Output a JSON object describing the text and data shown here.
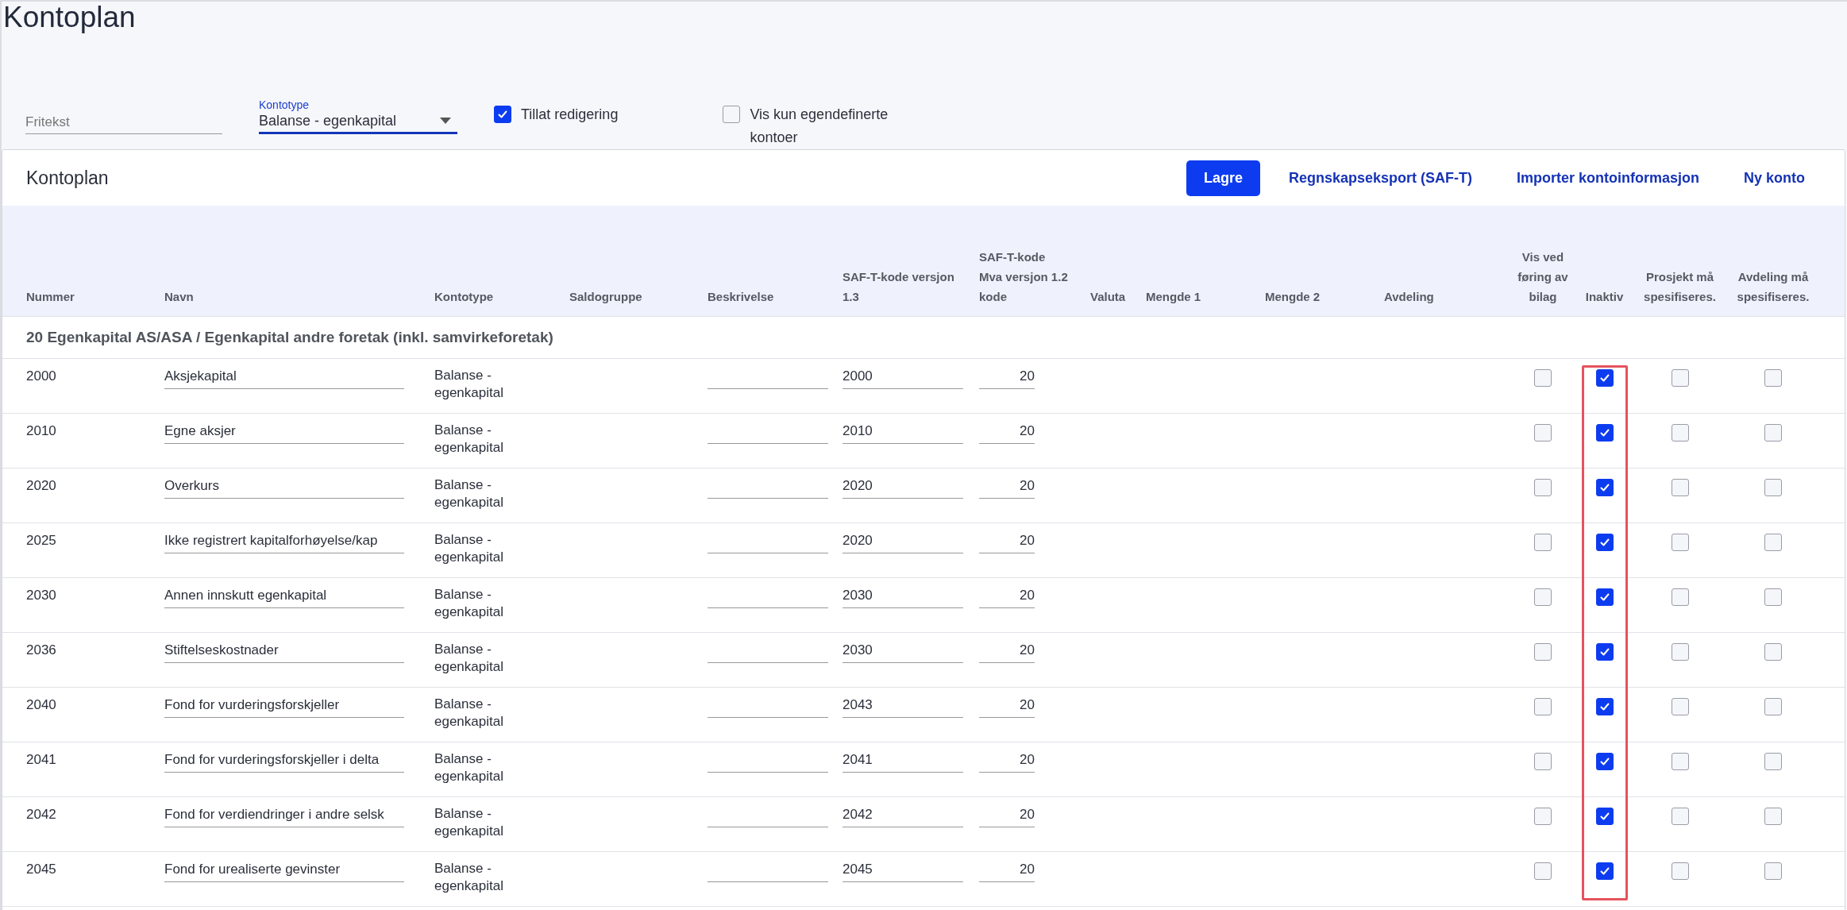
{
  "page_title": "Kontoplan",
  "filters": {
    "search": {
      "placeholder": "Fritekst"
    },
    "kontotype": {
      "label": "Kontotype",
      "value": "Balanse - egenkapital"
    },
    "checkboxes": [
      {
        "label": "Tillat redigering",
        "checked": true
      },
      {
        "label": "Vis kun egendefinerte kontoer",
        "checked": false
      }
    ]
  },
  "card_title": "Kontoplan",
  "actions": [
    {
      "label": "Lagre",
      "kind": "primary"
    },
    {
      "label": "Regnskapseksport (SAF-T)",
      "kind": "link"
    },
    {
      "label": "Importer kontoinformasjon",
      "kind": "link"
    },
    {
      "label": "Ny konto",
      "kind": "link"
    }
  ],
  "columns": [
    {
      "label": "Nummer",
      "kind": "text",
      "highlighted": false
    },
    {
      "label": "Navn",
      "kind": "text",
      "highlighted": false
    },
    {
      "label": "Kontotype",
      "kind": "text",
      "highlighted": false
    },
    {
      "label": "Saldogruppe",
      "kind": "text",
      "highlighted": false
    },
    {
      "label": "Beskrivelse",
      "kind": "text",
      "highlighted": false
    },
    {
      "label": "SAF-T-kode versjon 1.3",
      "kind": "text",
      "highlighted": false
    },
    {
      "label": "SAF-T-kode Mva versjon 1.2 kode",
      "kind": "text",
      "highlighted": false
    },
    {
      "label": "Valuta",
      "kind": "text",
      "highlighted": false
    },
    {
      "label": "Mengde 1",
      "kind": "text",
      "highlighted": false
    },
    {
      "label": "Mengde 2",
      "kind": "text",
      "highlighted": false
    },
    {
      "label": "Avdeling",
      "kind": "text",
      "highlighted": false
    },
    {
      "label": "Vis ved føring av bilag",
      "kind": "check",
      "highlighted": false
    },
    {
      "label": "Inaktiv",
      "kind": "check",
      "highlighted": true
    },
    {
      "label": "Prosjekt må spesifiseres.",
      "kind": "check",
      "highlighted": false
    },
    {
      "label": "Avdeling må spesifiseres.",
      "kind": "check",
      "highlighted": false
    }
  ],
  "group_title": "20 Egenkapital AS/ASA / Egenkapital andre foretak (inkl. samvirkeforetak)",
  "rows": [
    {
      "nummer": "2000",
      "navn": "Aksjekapital",
      "kontotype": "Balanse - egenkapital",
      "saft_13": "2000",
      "saft_mva": "20",
      "vis_ved_foering": false,
      "inaktiv": true,
      "prosjekt": false,
      "avdeling": false
    },
    {
      "nummer": "2010",
      "navn": "Egne aksjer",
      "kontotype": "Balanse - egenkapital",
      "saft_13": "2010",
      "saft_mva": "20",
      "vis_ved_foering": false,
      "inaktiv": true,
      "prosjekt": false,
      "avdeling": false
    },
    {
      "nummer": "2020",
      "navn": "Overkurs",
      "kontotype": "Balanse - egenkapital",
      "saft_13": "2020",
      "saft_mva": "20",
      "vis_ved_foering": false,
      "inaktiv": true,
      "prosjekt": false,
      "avdeling": false
    },
    {
      "nummer": "2025",
      "navn": "Ikke registrert kapitalforhøyelse/kap",
      "kontotype": "Balanse - egenkapital",
      "saft_13": "2020",
      "saft_mva": "20",
      "vis_ved_foering": false,
      "inaktiv": true,
      "prosjekt": false,
      "avdeling": false
    },
    {
      "nummer": "2030",
      "navn": "Annen innskutt egenkapital",
      "kontotype": "Balanse - egenkapital",
      "saft_13": "2030",
      "saft_mva": "20",
      "vis_ved_foering": false,
      "inaktiv": true,
      "prosjekt": false,
      "avdeling": false
    },
    {
      "nummer": "2036",
      "navn": "Stiftelseskostnader",
      "kontotype": "Balanse - egenkapital",
      "saft_13": "2030",
      "saft_mva": "20",
      "vis_ved_foering": false,
      "inaktiv": true,
      "prosjekt": false,
      "avdeling": false
    },
    {
      "nummer": "2040",
      "navn": "Fond for vurderingsforskjeller",
      "kontotype": "Balanse - egenkapital",
      "saft_13": "2043",
      "saft_mva": "20",
      "vis_ved_foering": false,
      "inaktiv": true,
      "prosjekt": false,
      "avdeling": false
    },
    {
      "nummer": "2041",
      "navn": "Fond for vurderingsforskjeller i delta",
      "kontotype": "Balanse - egenkapital",
      "saft_13": "2041",
      "saft_mva": "20",
      "vis_ved_foering": false,
      "inaktiv": true,
      "prosjekt": false,
      "avdeling": false
    },
    {
      "nummer": "2042",
      "navn": "Fond for verdiendringer i andre selsk",
      "kontotype": "Balanse - egenkapital",
      "saft_13": "2042",
      "saft_mva": "20",
      "vis_ved_foering": false,
      "inaktiv": true,
      "prosjekt": false,
      "avdeling": false
    },
    {
      "nummer": "2045",
      "navn": "Fond for urealiserte gevinster",
      "kontotype": "Balanse - egenkapital",
      "saft_13": "2045",
      "saft_mva": "20",
      "vis_ved_foering": false,
      "inaktiv": true,
      "prosjekt": false,
      "avdeling": false
    }
  ]
}
